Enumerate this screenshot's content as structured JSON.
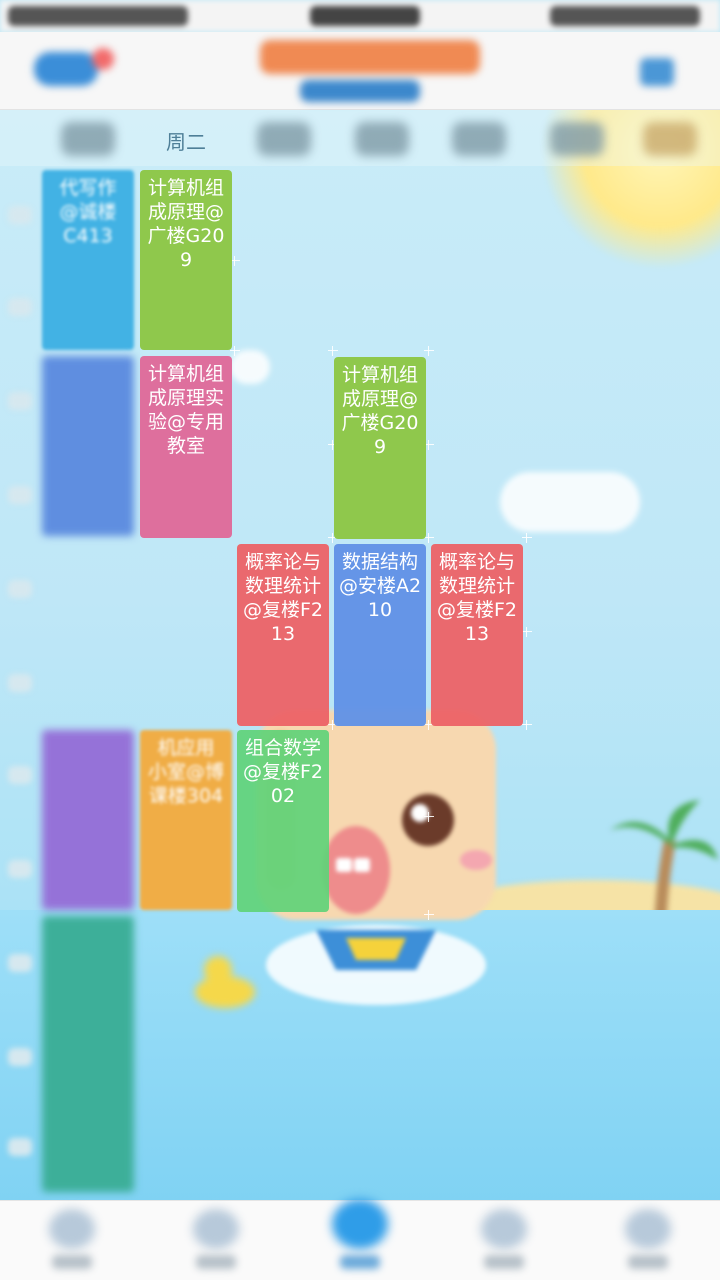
{
  "week_header": {
    "visible_day": "周二"
  },
  "courses": [
    {
      "id": "c1",
      "text": "计算机组成原理@广楼G209",
      "color": "#8fc84c"
    },
    {
      "id": "c2",
      "text": "计算机组成原理实验@专用教室",
      "color": "#de6f9d"
    },
    {
      "id": "c3",
      "text": "计算机组成原理@广楼G209",
      "color": "#8fc84c"
    },
    {
      "id": "c4",
      "text": "概率论与数理统计@复楼F213",
      "color": "#ec6266"
    },
    {
      "id": "c5",
      "text": "数据结构@安楼A210",
      "color": "#6192e6"
    },
    {
      "id": "c6",
      "text": "概率论与数理统计@复楼F213",
      "color": "#ec6266"
    },
    {
      "id": "c7",
      "text": "组合数学@复楼F202",
      "color": "#60d278"
    },
    {
      "id": "c8",
      "text": "机应用\n小室@博\n课楼304",
      "color": "#f0ad46"
    },
    {
      "id": "c9",
      "text": "代写作\n@诚楼\nC413",
      "color": "#42b2e4"
    }
  ],
  "icons": {
    "tab1": "home-icon",
    "tab2": "discover-icon",
    "tab3": "schedule-icon",
    "tab4": "message-icon",
    "tab5": "profile-icon",
    "menu": "list-menu-icon"
  }
}
